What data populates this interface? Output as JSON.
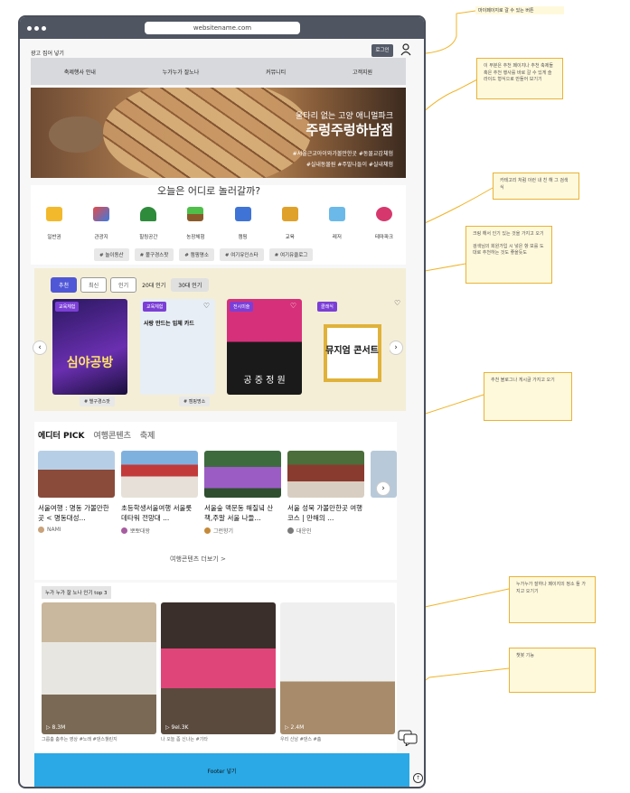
{
  "browser": {
    "url": "websitename.com"
  },
  "header": {
    "ad_text": "광고 집어 넣기",
    "login": "로그인"
  },
  "nav": {
    "items": [
      "축제행사 안내",
      "누가누가 잘노나",
      "커뮤니티",
      "고객지원"
    ]
  },
  "hero": {
    "subtitle": "울타리 없는 고양 애니멀파크",
    "title": "주렁주렁하남점",
    "tags_line1": "#서울근교아이와가볼만한곳 #동물교감체험",
    "tags_line2": "#실내동물원 #주말나들이 #실내체험"
  },
  "categories": {
    "question": "오늘은 어디로 놀러갈까?",
    "items": [
      "일반권",
      "관광지",
      "힐링공간",
      "농장체험",
      "캠핑",
      "교육",
      "레저",
      "테마파크"
    ],
    "tags": [
      "# 놀이동산",
      "# 볼구경스팟",
      "# 캠핑명소",
      "# 여기유인스타",
      "# 여기유클로그"
    ]
  },
  "recommend": {
    "tabs": [
      "추천",
      "최신",
      "인기",
      "20대 인기",
      "30대 인기"
    ],
    "cards": [
      {
        "badge": "교육체험",
        "text": "심야공방",
        "tag": "# 별구경스팟"
      },
      {
        "badge": "교육체험",
        "text": "사랑 만드는 입체 카드",
        "tag": "# 캠핑명소"
      },
      {
        "badge": "전시미술",
        "text": "공 중 정 원",
        "tag": ""
      },
      {
        "badge": "클래식",
        "text": "뮤지엄 콘서트",
        "tag": ""
      }
    ]
  },
  "editor": {
    "tabs": [
      "에디터 PICK",
      "여행콘텐츠",
      "축제"
    ],
    "cards": [
      {
        "title": "서울여행 : 명동 가볼만한 곳 < 명동대성...",
        "user": "NAMI"
      },
      {
        "title": "초등학생서울여행 서울롯데타워 전망대 ...",
        "user": "뽀뽀대왕"
      },
      {
        "title": "서울숲 맥문동 해질녘 산책,주말 서울 나들...",
        "user": "그런향기"
      },
      {
        "title": "서울 성북 가볼만한곳 여행코스 | 만해의 ...",
        "user": "대운인"
      }
    ],
    "more": "여행콘텐츠 더보기 >"
  },
  "top3": {
    "label": "누가 누가 잘 노나 인기 top 3",
    "videos": [
      {
        "views": "▷ 8.3M",
        "caption": "그룹춤 춤추는 영상 #노래 #댄스챌린지"
      },
      {
        "views": "▷ 9eI.3K",
        "caption": "나 오늘 좀 신나는 #기타"
      },
      {
        "views": "▷ 2.4M",
        "caption": "우리 신남 #댄스 #춤"
      }
    ]
  },
  "footer": {
    "label": "Footer 넣기"
  },
  "notes": {
    "n1": "마이페이지로 갈 수 있는 버튼",
    "n2": "이 부분은 추천 페이지나 추천 축제들 혹은 추천 행사를 바로 갈 수 있게 슬라이드 형식으로 만들어 보기기",
    "n3": "카테고리 처럼 이런 내 친 해 그 검색식",
    "n4a": "크링 해서 인기 있는 것을 가지고 오기",
    "n4b": "검색님의 회원가입 시 넣은 항 보를 도대로 추천하는 것도 좋을듯도",
    "n5": "추천 블로그나 게시글 가지고 오기",
    "n6": "누가누가 잘하나 페이지의 정소 들 가지고 오기기",
    "n7": "챗봇 기능"
  },
  "colors": {
    "frame": "#4a4f5a",
    "accent": "#4f57d6",
    "footer": "#2aa9e6",
    "note_border": "#e9b238"
  }
}
